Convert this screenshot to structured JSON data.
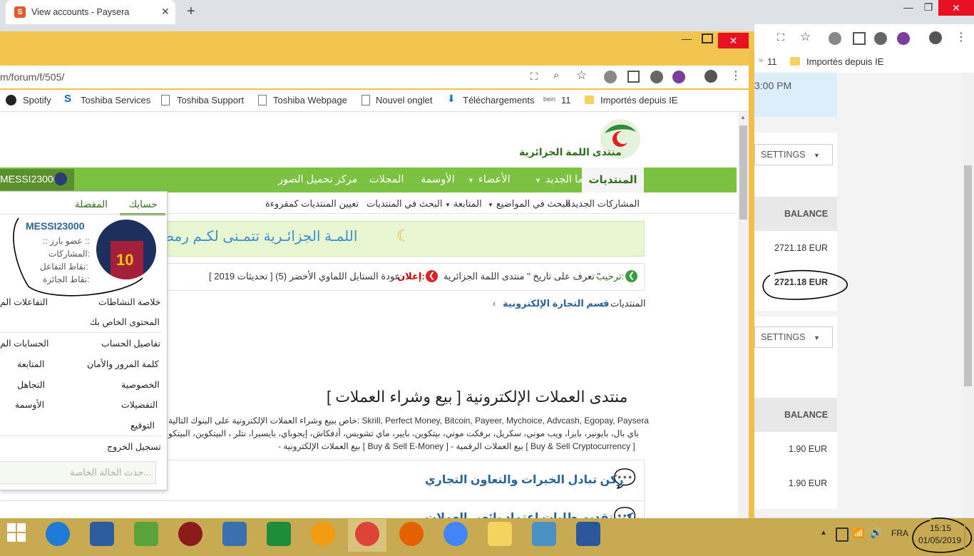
{
  "bg_window": {
    "tab_title": "View accounts - Paysera",
    "bookmark_count": "11",
    "bookmark_folder": "Importés depuis IE",
    "time_fragment": "3:00 PM",
    "settings_label": "SETTINGS",
    "balance_header": "BALANCE",
    "balances_1": [
      "2721.18 EUR",
      "2721.18 EUR"
    ],
    "balances_2": [
      "1.90 EUR",
      "1.90 EUR"
    ]
  },
  "fg_window": {
    "url": "m/forum/f/505/",
    "bookmarks": [
      "Spotify",
      "Toshiba Services",
      "Toshiba Support",
      "Toshiba Webpage",
      "Nouvel onglet",
      "Téléchargements",
      "11",
      "Importés depuis IE"
    ]
  },
  "forum": {
    "logo_tagline": "منتدى اللمة الجزائرية",
    "nav": [
      "المنتديات",
      "ما الجديد",
      "الأعضاء",
      "الأوسمة",
      "المجلات",
      "مركز تحميل الصور"
    ],
    "subnav": [
      "المشاركات الجديدة",
      "البحث في المواضيع",
      "المتابعة",
      "البحث في المنتديات",
      "تعيين المنتديات كمقروءة"
    ],
    "banner": "اللمـة الجزائـرية تتمـنى لكـم رمض",
    "notice_welcome": "ترحيب:",
    "notice_text1": "تعرف على تاريخ \" منتدى اللمة الجزائرية \"",
    "notice_announce": "إعلان:",
    "notice_text2": "[ تحديثات 2019 ] (5) عودة الستايل اللماوي الأخضر",
    "breadcrumb_home": "المنتديات",
    "breadcrumb_section": "قسم التجارة الإلكترونية",
    "forum_title": "منتدى العملات الإلكترونية [ بيع وشراء العملات ]",
    "desc_line1": "خاص ببيع وشراء العملات الإلكترونية على البنوك التالية: Skrill, Perfect Money, Bitcoin, Payeer, Mychoice, Advcash, Egopay, Paysera",
    "desc_line2": "باي بال، بايونير، بايزا، ويب موني، سكريل، برفكت موني، بيتكوين، بايير، ماي تشويس، أدفكاش، إيجوباي، بايسيرا، نتلر ، البيتكوين، البيتكو",
    "desc_line3": "- بيع العملات الإلكترونية [ Buy & Sell E-Money ] - بيع العملات الرقمية [ Buy & Sell Cryptocurrency ]",
    "node1_title": "ركن تبادل الخبرات والتعاون التجاري",
    "node2_title": "ركن تقديم طلبات إعتماد بائعي العملات"
  },
  "user_menu": {
    "username": "MESSI23000",
    "tab_account": "حسابك",
    "tab_favorites": "المفضلة",
    "rank": ":: عضو بارز ::",
    "posts_label": "المشاركات:",
    "reactions_label": "نقاط التفاعل:",
    "trophy_label": "نقاط الجائزة:",
    "items_right": [
      "خلاصة النشاطات",
      "المحتوى الخاص بك",
      "تفاصيل الحساب",
      "كلمة المرور والأمان",
      "الخصوصية",
      "التفضيلات",
      "التوقيع",
      "تسجيل الخروج"
    ],
    "items_left": [
      "التفاعلات الم",
      "الحسابات الم",
      "المتابعة",
      "التجاهل",
      "الأوسمة"
    ],
    "status_placeholder": "حدث الحالة الخاصة..."
  },
  "taskbar": {
    "lang": "FRA",
    "time": "15:15",
    "date": "01/05/2019"
  },
  "colors": {
    "forum_green": "#7cc242",
    "frame_yellow": "#f2c550",
    "taskbar": "#c7aa52",
    "link_blue": "#2a6496"
  }
}
